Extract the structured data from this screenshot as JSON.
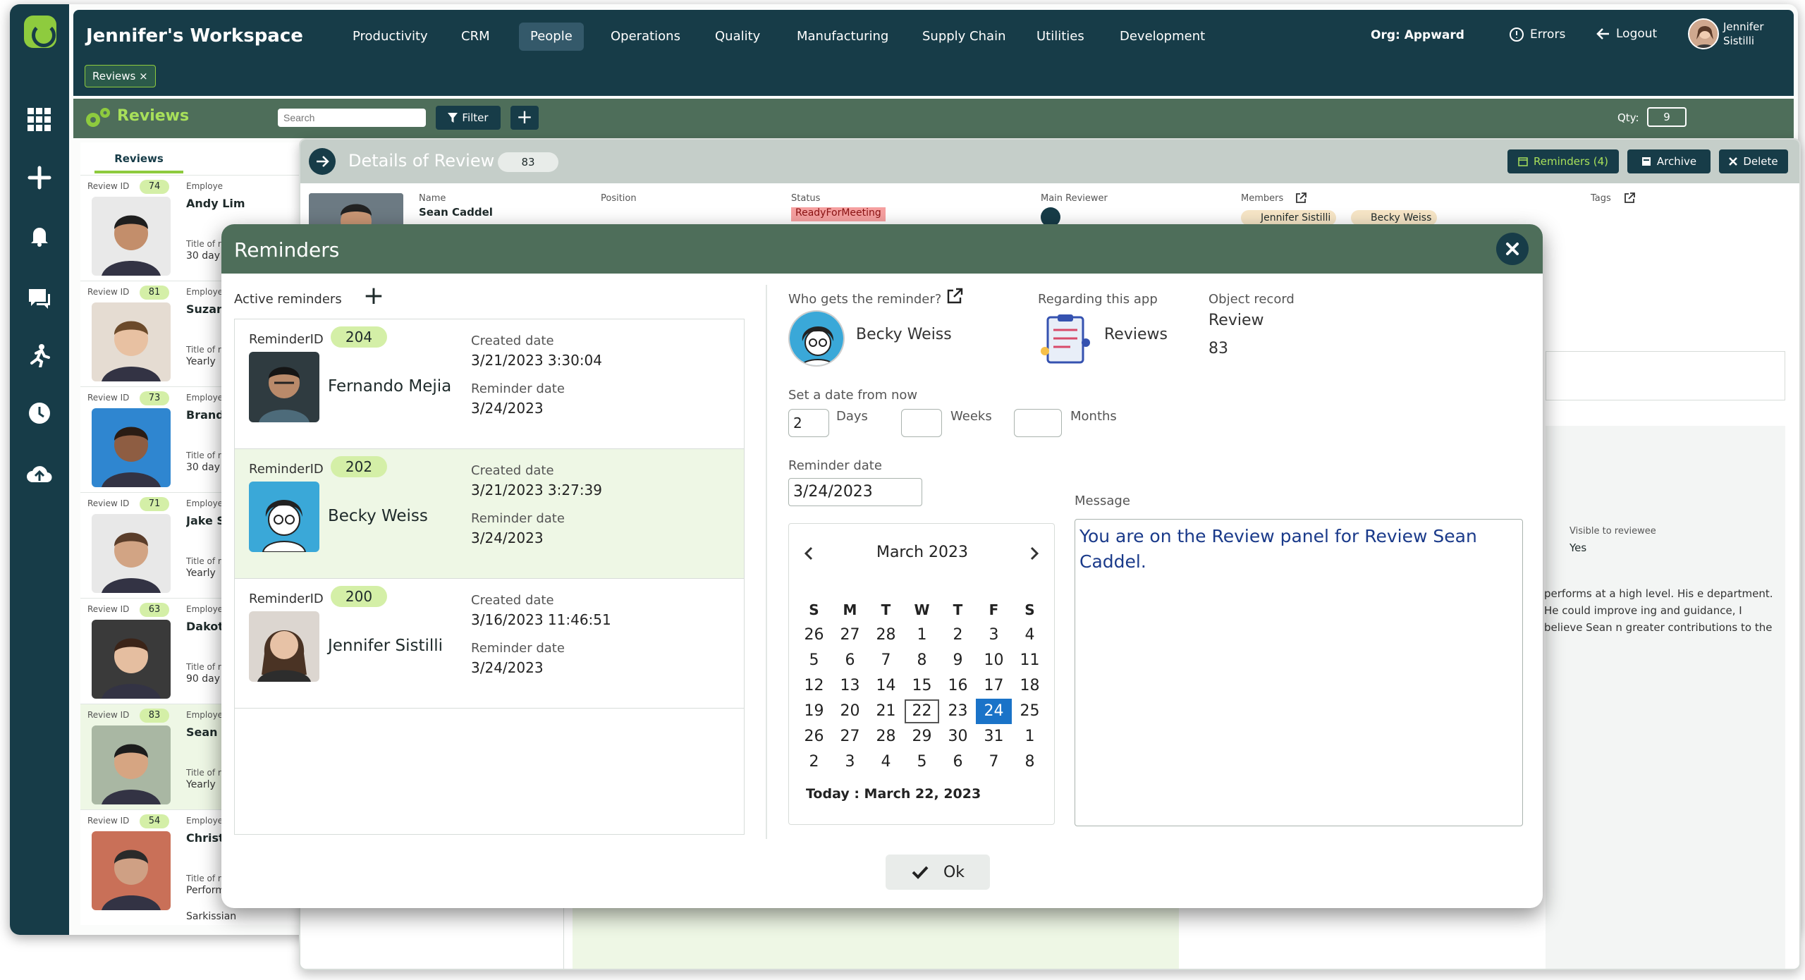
{
  "topbar": {
    "workspace_title": "Jennifer's Workspace",
    "nav": [
      "Productivity",
      "CRM",
      "People",
      "Operations",
      "Quality",
      "Manufacturing",
      "Supply Chain",
      "Utilities",
      "Development"
    ],
    "active_nav": "People",
    "org_label": "Org:  Appward",
    "errors_label": "Errors",
    "logout_label": "Logout",
    "user_name": "Jennifer Sistilli",
    "open_tab": "Reviews"
  },
  "sidebar": {
    "icons": [
      "apps-grid-icon",
      "plus-icon",
      "bell-icon",
      "chat-icon",
      "run-icon",
      "clock-icon",
      "cloud-upload-icon"
    ]
  },
  "toolbar": {
    "title": "Reviews",
    "search_placeholder": "Search",
    "filter_label": "Filter",
    "qty_label": "Qty:",
    "qty_value": "9"
  },
  "list": {
    "tab": "Reviews",
    "rows": [
      {
        "id": "74",
        "name": "Andy Lim",
        "sub1": "Title of r",
        "sub2": "30 day"
      },
      {
        "id": "81",
        "name": "Suzan",
        "sub1": "Title of r",
        "sub2": "Yearly"
      },
      {
        "id": "73",
        "name": "Brand",
        "sub1": "Title of r",
        "sub2": "30 day"
      },
      {
        "id": "71",
        "name": "Jake S",
        "sub1": "Title of r",
        "sub2": "Yearly"
      },
      {
        "id": "63",
        "name": "Dakot",
        "sub1": "Title of r",
        "sub2": "90 day"
      },
      {
        "id": "83",
        "name": "Sean C",
        "sub1": "Title of r",
        "sub2": "Yearly"
      },
      {
        "id": "54",
        "name": "Christ",
        "sub1": "Title of r",
        "sub2": "Perform"
      }
    ],
    "rid_label": "Review ID",
    "employee_label": "Employe",
    "extra_line": "Sarkissian"
  },
  "details": {
    "title": "Details of Review",
    "count": "83",
    "reminders_btn": "Reminders (4)",
    "archive_btn": "Archive",
    "delete_btn": "Delete",
    "name_label": "Name",
    "name_value": "Sean Caddel",
    "position_label": "Position",
    "status_label": "Status",
    "status_value": "ReadyForMeeting",
    "main_reviewer_label": "Main Reviewer",
    "members_label": "Members",
    "members": [
      "Jennifer Sistilli",
      "Becky Weiss"
    ],
    "tags_label": "Tags",
    "visible_label": "Visible to reviewee",
    "visible_value": "Yes",
    "review_text": "performs at a high level. His e department. He could improve ing and guidance, I believe Sean n greater contributions to the"
  },
  "modal": {
    "title": "Reminders",
    "active_label": "Active reminders",
    "reminder_id_label": "ReminderID",
    "created_label": "Created date",
    "reminder_date_label": "Reminder date",
    "reminders": [
      {
        "id": "204",
        "name": "Fernando Mejia",
        "created": "3/21/2023 3:30:04",
        "date": "3/24/2023"
      },
      {
        "id": "202",
        "name": "Becky Weiss",
        "created": "3/21/2023 3:27:39",
        "date": "3/24/2023"
      },
      {
        "id": "200",
        "name": "Jennifer Sistilli",
        "created": "3/16/2023 11:46:51",
        "date": "3/24/2023"
      }
    ],
    "who_label": "Who gets the reminder?",
    "who_value": "Becky Weiss",
    "app_label": "Regarding this app",
    "app_value": "Reviews",
    "object_label": "Object record",
    "object_value": "Review",
    "object_id": "83",
    "set_date_label": "Set a date from now",
    "days_value": "2",
    "days_label": "Days",
    "weeks_value": "",
    "weeks_label": "Weeks",
    "months_value": "",
    "months_label": "Months",
    "reminder_date_field_label": "Reminder date",
    "reminder_date_value": "3/24/2023",
    "message_label": "Message",
    "message": "You are on the Review panel for Review Sean Caddel.",
    "ok_label": "Ok"
  },
  "calendar": {
    "month": "March 2023",
    "dows": [
      "S",
      "M",
      "T",
      "W",
      "T",
      "F",
      "S"
    ],
    "days": [
      "26",
      "27",
      "28",
      "1",
      "2",
      "3",
      "4",
      "5",
      "6",
      "7",
      "8",
      "9",
      "10",
      "11",
      "12",
      "13",
      "14",
      "15",
      "16",
      "17",
      "18",
      "19",
      "20",
      "21",
      "22",
      "23",
      "24",
      "25",
      "26",
      "27",
      "28",
      "29",
      "30",
      "31",
      "1",
      "2",
      "3",
      "4",
      "5",
      "6",
      "7",
      "8"
    ],
    "today_day": "22",
    "selected_day": "24",
    "today_text": "Today : March 22, 2023"
  },
  "colors": {
    "navy": "#173c48",
    "green_accent": "#8ecb3e",
    "header_green": "#4e6e5a",
    "pill_green": "#d4efa7",
    "selected_blue": "#1a73c8",
    "status_red": "#f6a0a0"
  }
}
